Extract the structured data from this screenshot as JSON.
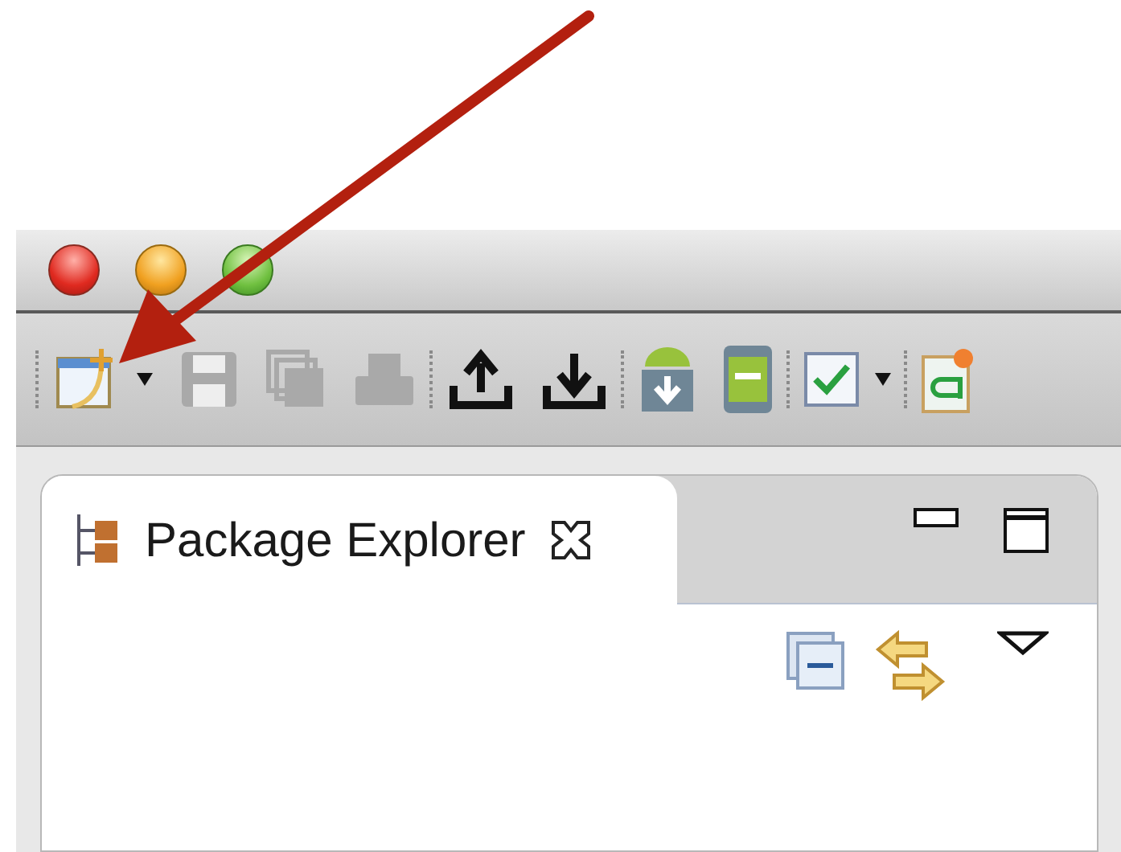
{
  "toolbar": {
    "groups": [
      {
        "items": [
          {
            "kind": "new",
            "disabled": false,
            "dropdown": true
          },
          {
            "kind": "save",
            "disabled": true,
            "dropdown": false
          },
          {
            "kind": "save_all",
            "disabled": true,
            "dropdown": false
          },
          {
            "kind": "print",
            "disabled": true,
            "dropdown": false
          }
        ]
      },
      {
        "items": [
          {
            "kind": "upload",
            "disabled": false,
            "dropdown": false
          },
          {
            "kind": "download",
            "disabled": false,
            "dropdown": false
          }
        ]
      },
      {
        "items": [
          {
            "kind": "android_download",
            "disabled": false,
            "dropdown": false
          },
          {
            "kind": "android_device",
            "disabled": false,
            "dropdown": false
          }
        ]
      },
      {
        "items": [
          {
            "kind": "check",
            "disabled": false,
            "dropdown": true
          }
        ]
      },
      {
        "items": [
          {
            "kind": "new_class",
            "disabled": false,
            "dropdown": false
          }
        ]
      }
    ]
  },
  "view": {
    "tabs": [
      {
        "label": "Package Explorer",
        "selected": true
      }
    ]
  }
}
